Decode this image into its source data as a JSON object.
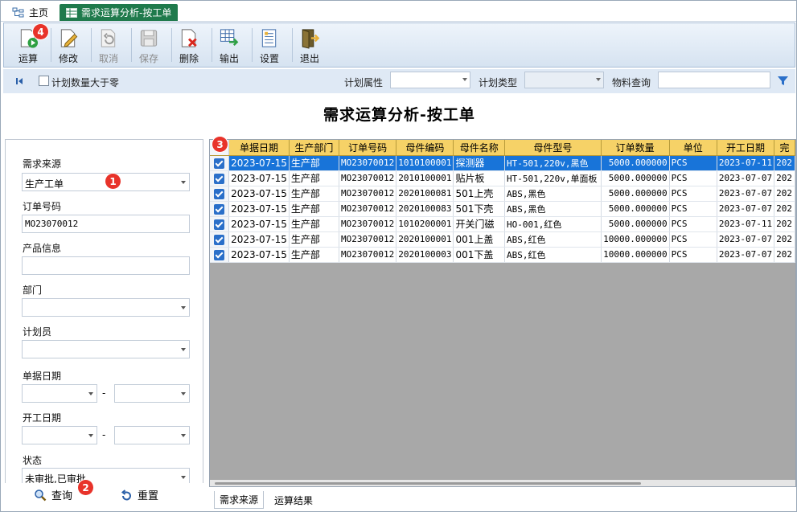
{
  "tabs": {
    "home": "主页",
    "active": "需求运算分析-按工单"
  },
  "toolbar": {
    "buttons": [
      {
        "label": "运算",
        "enabled": true
      },
      {
        "label": "修改",
        "enabled": true
      },
      {
        "label": "取消",
        "enabled": false
      },
      {
        "label": "保存",
        "enabled": false
      },
      {
        "label": "删除",
        "enabled": true
      },
      {
        "label": "输出",
        "enabled": true
      },
      {
        "label": "设置",
        "enabled": true
      },
      {
        "label": "退出",
        "enabled": true
      }
    ]
  },
  "badges": [
    "1",
    "2",
    "3",
    "4"
  ],
  "filterbar": {
    "checkbox_label": "计划数量大于零",
    "plan_attr_label": "计划属性",
    "plan_type_label": "计划类型",
    "material_query_label": "物料查询"
  },
  "page_title": "需求运算分析-按工单",
  "leftpanel": {
    "source_label": "需求来源",
    "source_value": "生产工单",
    "order_label": "订单号码",
    "order_value": "MO23070012",
    "product_label": "产品信息",
    "dept_label": "部门",
    "planner_label": "计划员",
    "doc_date_label": "单据日期",
    "start_date_label": "开工日期",
    "status_label": "状态",
    "status_value": "未审批,已审批",
    "dash": "-",
    "query_button": "查询",
    "reset_button": "重置"
  },
  "grid": {
    "columns": [
      "单据日期",
      "生产部门",
      "订单号码",
      "母件编码",
      "母件名称",
      "母件型号",
      "订单数量",
      "单位",
      "开工日期",
      "完"
    ],
    "rows": [
      [
        "2023-07-15",
        "生产部",
        "MO23070012",
        "1010100001",
        "探测器",
        "HT-501,220v,黑色",
        "5000.000000",
        "PCS",
        "2023-07-11",
        "202"
      ],
      [
        "2023-07-15",
        "生产部",
        "MO23070012",
        "2010100001",
        "贴片板",
        "HT-501,220v,单面板",
        "5000.000000",
        "PCS",
        "2023-07-07",
        "202"
      ],
      [
        "2023-07-15",
        "生产部",
        "MO23070012",
        "2020100081",
        "501上壳",
        "ABS,黑色",
        "5000.000000",
        "PCS",
        "2023-07-07",
        "202"
      ],
      [
        "2023-07-15",
        "生产部",
        "MO23070012",
        "2020100083",
        "501下壳",
        "ABS,黑色",
        "5000.000000",
        "PCS",
        "2023-07-07",
        "202"
      ],
      [
        "2023-07-15",
        "生产部",
        "MO23070012",
        "1010200001",
        "开关门磁",
        "HO-001,红色",
        "5000.000000",
        "PCS",
        "2023-07-11",
        "202"
      ],
      [
        "2023-07-15",
        "生产部",
        "MO23070012",
        "2020100001",
        "001上盖",
        "ABS,红色",
        "10000.000000",
        "PCS",
        "2023-07-07",
        "202"
      ],
      [
        "2023-07-15",
        "生产部",
        "MO23070012",
        "2020100003",
        "001下盖",
        "ABS,红色",
        "10000.000000",
        "PCS",
        "2023-07-07",
        "202"
      ]
    ]
  },
  "bottom_tabs": [
    "需求来源",
    "运算结果"
  ],
  "colors": {
    "accent_tab": "#1f7a4c",
    "header": "#f6d267",
    "selected_row": "#1874d9",
    "badge": "#e8332a"
  }
}
